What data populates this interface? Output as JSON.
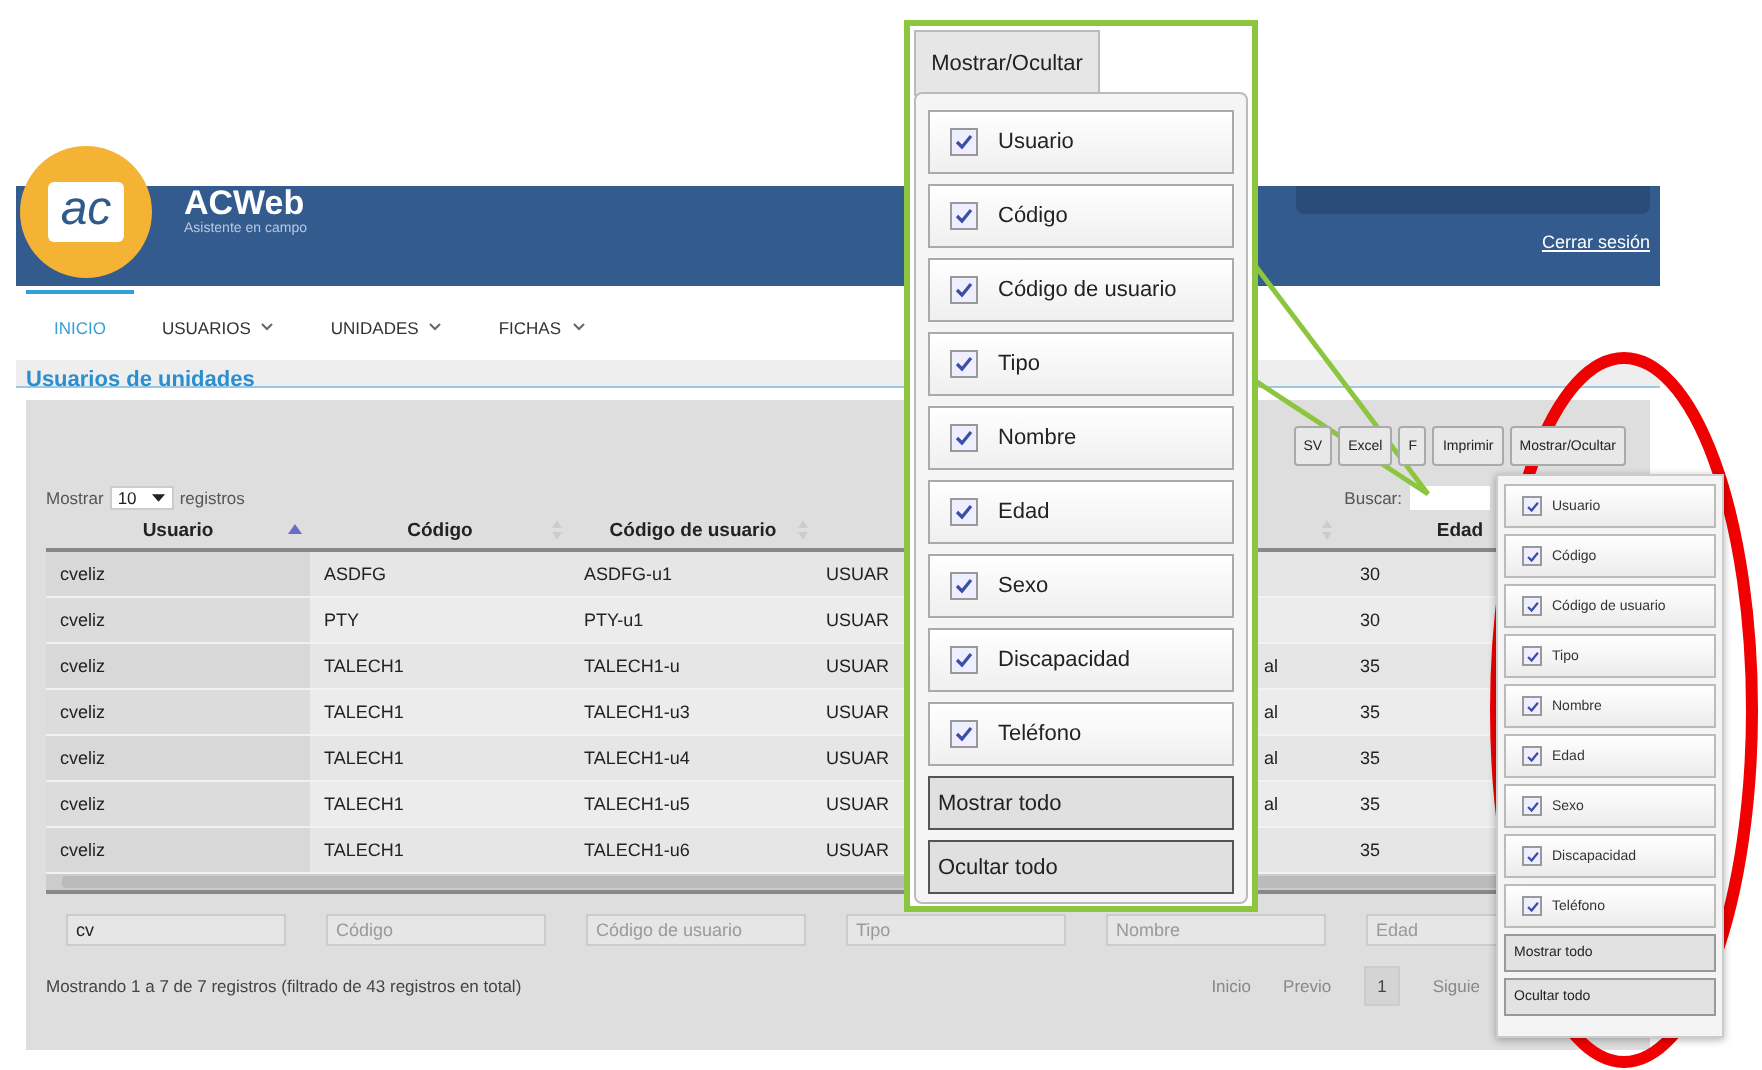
{
  "header": {
    "logo_text": "ac",
    "app_name": "ACWeb",
    "tagline": "Asistente en campo",
    "logout_link": "Cerrar sesión"
  },
  "nav": [
    {
      "label": "INICIO",
      "selected": true,
      "dropdown": false
    },
    {
      "label": "USUARIOS",
      "selected": false,
      "dropdown": true
    },
    {
      "label": "UNIDADES",
      "selected": false,
      "dropdown": true
    },
    {
      "label": "FICHAS",
      "selected": false,
      "dropdown": true
    }
  ],
  "page_title": "Usuarios de unidades",
  "toolbar": [
    "SV",
    "Excel",
    "F",
    "Imprimir",
    "Mostrar/Ocultar"
  ],
  "length_menu": {
    "prefix": "Mostrar",
    "value": "10",
    "suffix": "registros"
  },
  "search": {
    "label": "Buscar:"
  },
  "table": {
    "columns": [
      {
        "label": "Usuario",
        "sorted": true
      },
      {
        "label": "Código",
        "sorted": false
      },
      {
        "label": "Código de usuario",
        "sorted": false
      },
      {},
      {
        "sorted": false
      },
      {
        "label": "Edad"
      }
    ],
    "rows": [
      [
        "cveliz",
        "ASDFG",
        "ASDFG-u1",
        "USUAR",
        null,
        "30"
      ],
      [
        "cveliz",
        "PTY",
        "PTY-u1",
        "USUAR",
        null,
        "30"
      ],
      [
        "cveliz",
        "TALECH1",
        "TALECH1-u",
        "USUAR",
        "al",
        "35"
      ],
      [
        "cveliz",
        "TALECH1",
        "TALECH1-u3",
        "USUAR",
        "al",
        "35"
      ],
      [
        "cveliz",
        "TALECH1",
        "TALECH1-u4",
        "USUAR",
        "al",
        "35"
      ],
      [
        "cveliz",
        "TALECH1",
        "TALECH1-u5",
        "USUAR",
        "al",
        "35"
      ],
      [
        "cveliz",
        "TALECH1",
        "TALECH1-u6",
        "USUAR",
        null,
        "35"
      ]
    ],
    "filters": [
      {
        "value": "cv"
      },
      {
        "placeholder": "Código"
      },
      {
        "placeholder": "Código de usuario"
      },
      {
        "placeholder": "Tipo"
      },
      {
        "placeholder": "Nombre"
      },
      {
        "placeholder": "Edad"
      }
    ]
  },
  "info": "Mostrando 1 a 7 de 7 registros (filtrado de 43 registros en total)",
  "pagination": [
    {
      "label": "Inicio",
      "kind": "link"
    },
    {
      "label": "Previo",
      "kind": "link"
    },
    {
      "label": "1",
      "kind": "page",
      "selected": true
    },
    {
      "label": "Siguie",
      "kind": "link"
    }
  ],
  "column_menu": {
    "items": [
      {
        "label": "Usuario",
        "checked": true
      },
      {
        "label": "Código",
        "checked": true
      },
      {
        "label": "Código de usuario",
        "checked": true
      },
      {
        "label": "Tipo",
        "checked": true
      },
      {
        "label": "Nombre",
        "checked": true
      },
      {
        "label": "Edad",
        "checked": true
      },
      {
        "label": "Sexo",
        "checked": true
      },
      {
        "label": "Discapacidad",
        "checked": true
      },
      {
        "label": "Teléfono",
        "checked": true
      }
    ],
    "actions": [
      "Mostrar todo",
      "Ocultar todo"
    ]
  },
  "zoom_callout": {
    "button": "Mostrar/Ocultar",
    "items": [
      {
        "label": "Usuario",
        "checked": true
      },
      {
        "label": "Código",
        "checked": true
      },
      {
        "label": "Código de usuario",
        "checked": true
      },
      {
        "label": "Tipo",
        "checked": true
      },
      {
        "label": "Nombre",
        "checked": true
      },
      {
        "label": "Edad",
        "checked": true
      },
      {
        "label": "Sexo",
        "checked": true
      },
      {
        "label": "Discapacidad",
        "checked": true
      },
      {
        "label": "Teléfono",
        "checked": true
      }
    ],
    "actions": [
      "Mostrar todo",
      "Ocultar todo"
    ]
  }
}
